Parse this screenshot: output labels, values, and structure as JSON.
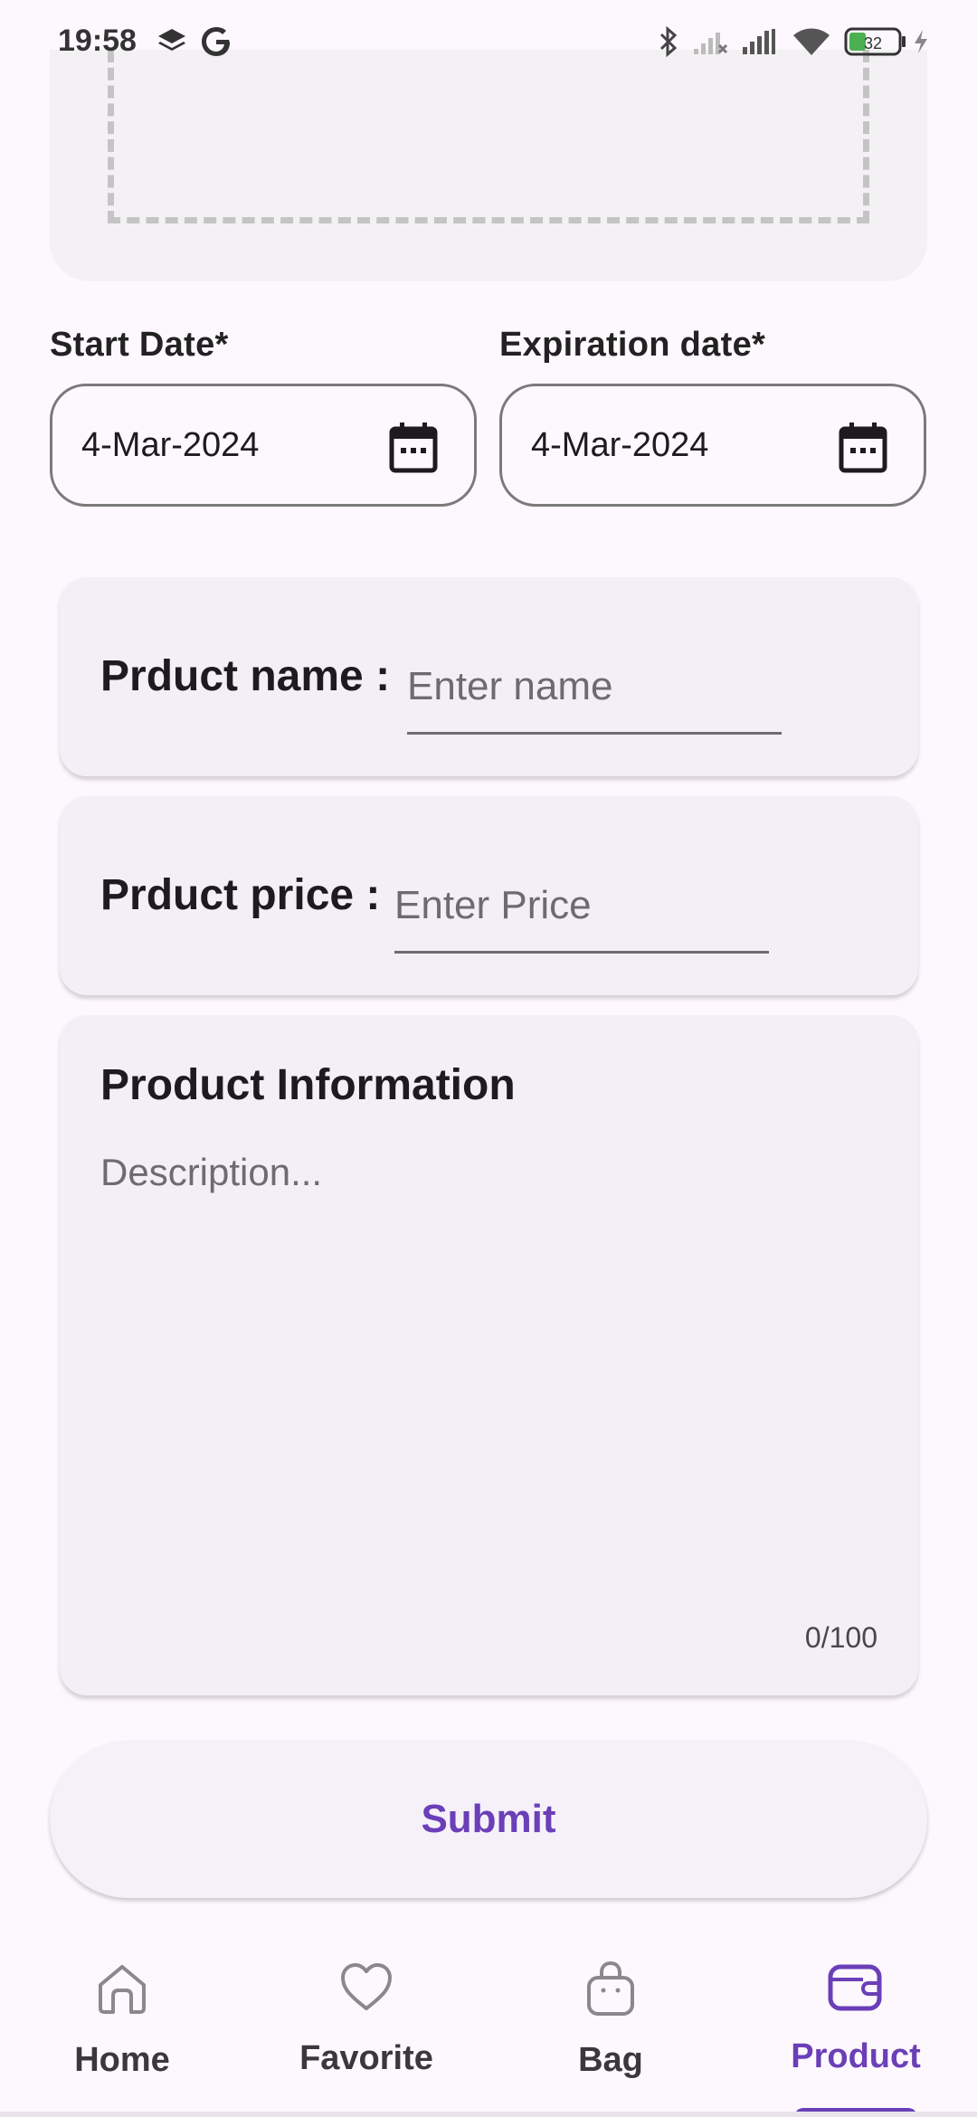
{
  "status_bar": {
    "time": "19:58",
    "battery": "32",
    "icons": [
      "layers-icon",
      "google-icon",
      "bluetooth-icon",
      "signal-off-icon",
      "signal-icon",
      "wifi-icon",
      "battery-icon",
      "charging-icon"
    ]
  },
  "form": {
    "start_date": {
      "label": "Start Date*",
      "value": "4-Mar-2024"
    },
    "expiration_date": {
      "label": "Expiration date*",
      "value": "4-Mar-2024"
    },
    "product_name": {
      "label": "Prduct name :",
      "placeholder": "Enter name"
    },
    "product_price": {
      "label": "Prduct price :",
      "placeholder": "Enter Price"
    },
    "product_info": {
      "title": "Product Information",
      "placeholder": "Description...",
      "counter": "0/100"
    },
    "submit_label": "Submit"
  },
  "nav": {
    "items": [
      {
        "label": "Home",
        "icon": "home-icon"
      },
      {
        "label": "Favorite",
        "icon": "heart-icon"
      },
      {
        "label": "Bag",
        "icon": "bag-icon"
      },
      {
        "label": "Product",
        "icon": "wallet-icon",
        "active": true
      }
    ]
  },
  "colors": {
    "accent": "#6a3fb8",
    "background": "#fdf8fd",
    "card": "#f4eff7"
  }
}
